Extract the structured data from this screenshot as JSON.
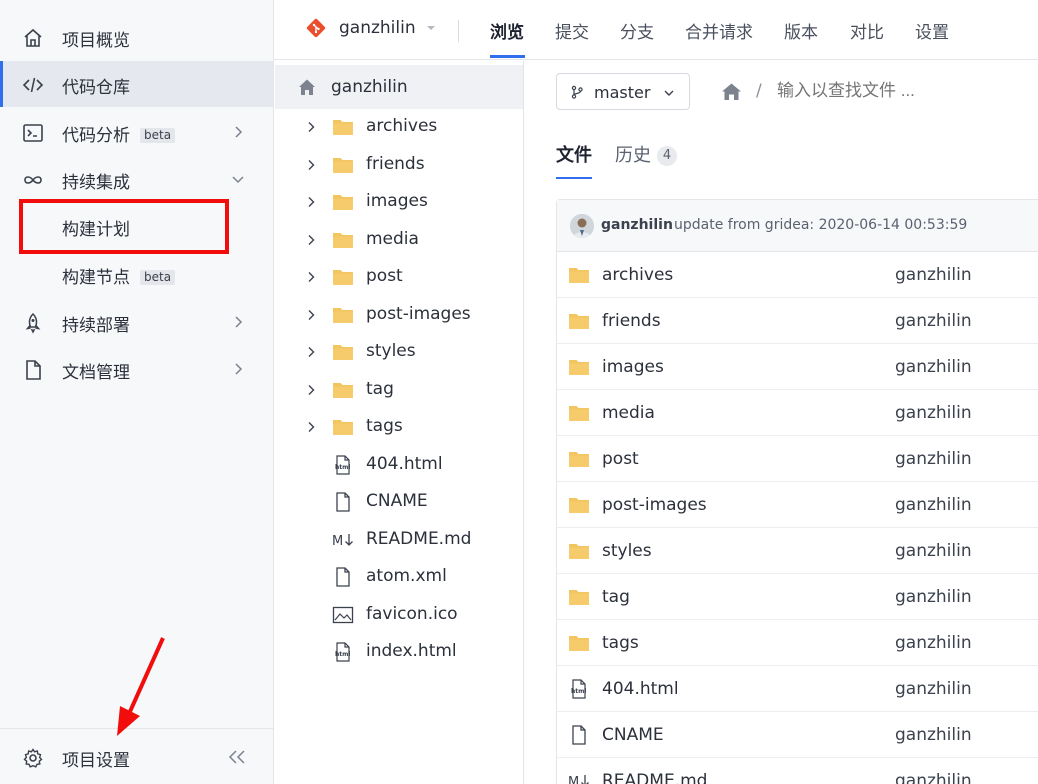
{
  "sidebar": {
    "items": [
      {
        "label": "项目概览",
        "icon": "home-icon"
      },
      {
        "label": "代码仓库",
        "icon": "code-icon"
      },
      {
        "label": "代码分析",
        "badge": "beta",
        "icon": "terminal-icon"
      },
      {
        "label": "持续集成",
        "icon": "infinity-icon"
      },
      {
        "label": "构建计划"
      },
      {
        "label": "构建节点",
        "badge": "beta"
      },
      {
        "label": "持续部署",
        "icon": "rocket-icon"
      },
      {
        "label": "文档管理",
        "icon": "document-icon"
      }
    ],
    "settings_label": "项目设置"
  },
  "topbar": {
    "repo_name": "ganzhilin",
    "tabs": [
      "浏览",
      "提交",
      "分支",
      "合并请求",
      "版本",
      "对比",
      "设置"
    ]
  },
  "tree": {
    "root": "ganzhilin",
    "folders": [
      "archives",
      "friends",
      "images",
      "media",
      "post",
      "post-images",
      "styles",
      "tag",
      "tags"
    ],
    "files": [
      {
        "name": "404.html",
        "icon": "html-file-icon"
      },
      {
        "name": "CNAME",
        "icon": "file-icon"
      },
      {
        "name": "README.md",
        "icon": "markdown-icon"
      },
      {
        "name": "atom.xml",
        "icon": "file-icon"
      },
      {
        "name": "favicon.ico",
        "icon": "image-file-icon"
      },
      {
        "name": "index.html",
        "icon": "html-file-icon"
      }
    ]
  },
  "main": {
    "branch": "master",
    "search_placeholder": "输入以查找文件 ...",
    "tabs": {
      "files": "文件",
      "history": "历史",
      "history_count": "4"
    },
    "commit": {
      "author": "ganzhilin",
      "message": "update from gridea: 2020-06-14 00:53:59"
    },
    "rows": [
      {
        "name": "archives",
        "author": "ganzhilin",
        "type": "folder"
      },
      {
        "name": "friends",
        "author": "ganzhilin",
        "type": "folder"
      },
      {
        "name": "images",
        "author": "ganzhilin",
        "type": "folder"
      },
      {
        "name": "media",
        "author": "ganzhilin",
        "type": "folder"
      },
      {
        "name": "post",
        "author": "ganzhilin",
        "type": "folder"
      },
      {
        "name": "post-images",
        "author": "ganzhilin",
        "type": "folder"
      },
      {
        "name": "styles",
        "author": "ganzhilin",
        "type": "folder"
      },
      {
        "name": "tag",
        "author": "ganzhilin",
        "type": "folder"
      },
      {
        "name": "tags",
        "author": "ganzhilin",
        "type": "folder"
      },
      {
        "name": "404.html",
        "author": "ganzhilin",
        "type": "html"
      },
      {
        "name": "CNAME",
        "author": "ganzhilin",
        "type": "file"
      },
      {
        "name": "README.md",
        "author": "ganzhilin",
        "type": "markdown"
      }
    ]
  },
  "colors": {
    "accent": "#2f6fed",
    "folder": "#f3c560",
    "annotation": "#f20d0d"
  }
}
